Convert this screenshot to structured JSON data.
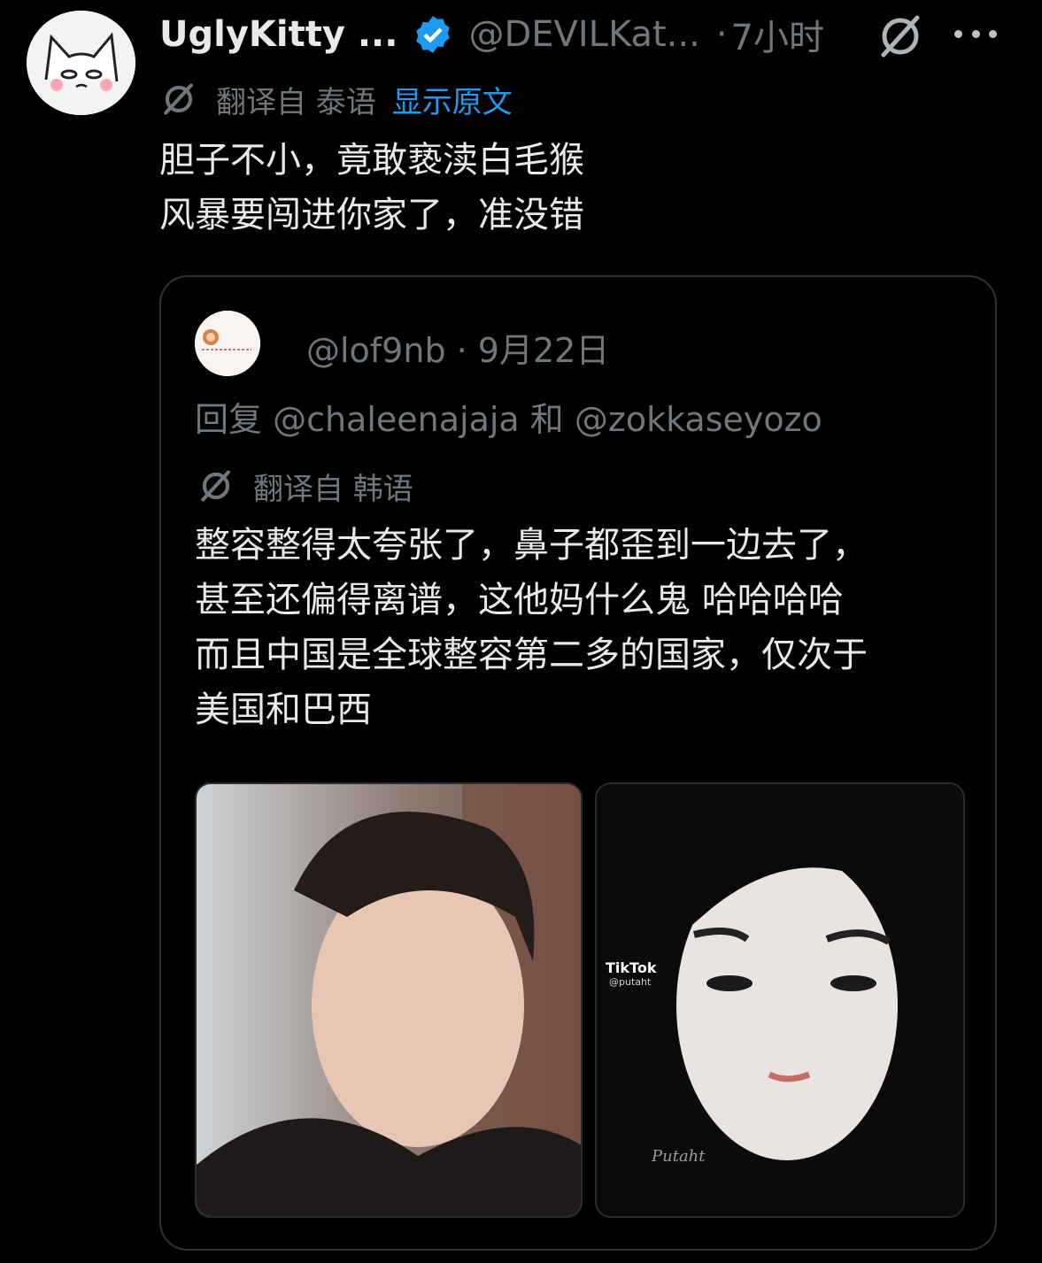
{
  "tweet": {
    "display_name": "UglyKitty ...",
    "handle": "@DEVILKat...",
    "separator": "·",
    "time": "7小时",
    "translation": {
      "label": "翻译自 泰语",
      "show_original": "显示原文"
    },
    "lines": [
      "胆子不小，竟敢亵渎白毛猴",
      "风暴要闯进你家了，准没错"
    ]
  },
  "quote": {
    "meta": "@lof9nb · 9月22日",
    "reply": "回复 @chaleenajaja 和 @zokkaseyozo",
    "translation_label": "翻译自 韩语",
    "lines": [
      "整容整得太夸张了，鼻子都歪到一边去了，",
      "甚至还偏得离谱，这他妈什么鬼 哈哈哈哈",
      "而且中国是全球整容第二多的国家，仅次于",
      "美国和巴西"
    ],
    "media": {
      "tiktok_label": "TikTok",
      "tiktok_handle": "@putaht",
      "watermark": "Putaht"
    }
  },
  "colors": {
    "background": "#000000",
    "text": "#e7e9ea",
    "muted": "#71767b",
    "link": "#1d9bf0",
    "verified": "#1d9bf0",
    "border": "#2f3336"
  },
  "icons": [
    "verified-badge-icon",
    "grok-icon",
    "more-icon",
    "translate-icon"
  ]
}
